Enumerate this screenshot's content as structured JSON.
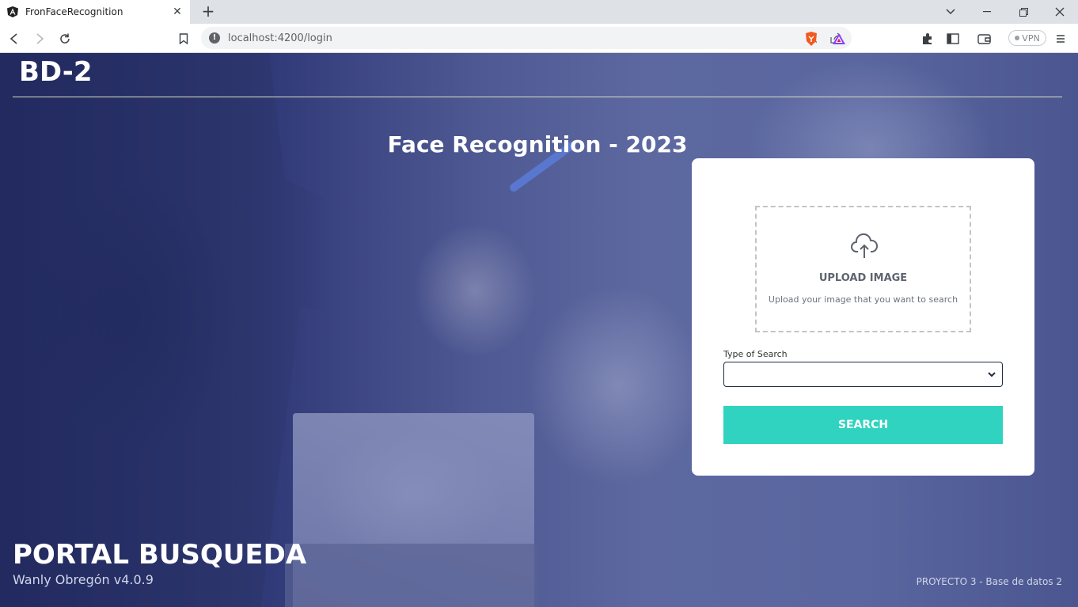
{
  "browser": {
    "tab_title": "FronFaceRecognition",
    "url": "localhost:4200/login",
    "vpn_label": "VPN"
  },
  "page": {
    "brand": "BD-2",
    "headline": "Face Recognition - 2023",
    "upload": {
      "title": "UPLOAD IMAGE",
      "subtitle": "Upload your image that you want to search"
    },
    "search_type_label": "Type of Search",
    "search_type_value": "",
    "search_button": "SEARCH",
    "portal_title": "PORTAL BUSQUEDA",
    "author": "Wanly Obregón v4.0.9",
    "project": "PROYECTO 3 - Base de datos 2"
  },
  "colors": {
    "accent": "#2fd3bf",
    "overlay": "#313a78"
  }
}
